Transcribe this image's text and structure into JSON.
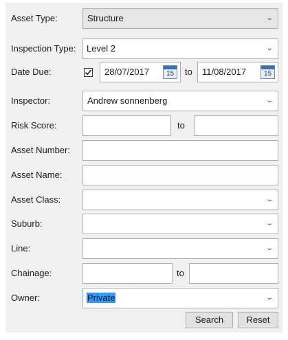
{
  "form": {
    "asset_type": {
      "label": "Asset Type:",
      "value": "Structure"
    },
    "inspection_type": {
      "label": "Inspection Type:",
      "value": "Level 2"
    },
    "date_due": {
      "label": "Date Due:",
      "checked": true,
      "from": "28/07/2017",
      "to_label": "to",
      "to": "11/08/2017",
      "calendar_day": "15"
    },
    "inspector": {
      "label": "Inspector:",
      "value": "Andrew sonnenberg"
    },
    "risk_score": {
      "label": "Risk Score:",
      "to_label": "to",
      "from": "",
      "to": ""
    },
    "asset_number": {
      "label": "Asset Number:",
      "value": ""
    },
    "asset_name": {
      "label": "Asset Name:",
      "value": ""
    },
    "asset_class": {
      "label": "Asset Class:",
      "value": ""
    },
    "suburb": {
      "label": "Suburb:",
      "value": ""
    },
    "line": {
      "label": "Line:",
      "value": ""
    },
    "chainage": {
      "label": "Chainage:",
      "to_label": "to",
      "from": "",
      "to": ""
    },
    "owner": {
      "label": "Owner:",
      "value": "Private"
    }
  },
  "buttons": {
    "search": "Search",
    "reset": "Reset"
  },
  "icons": {
    "dropdown": "chevron-down-icon",
    "calendar": "calendar-icon",
    "check": "checkmark-icon"
  },
  "colors": {
    "selection": "#3399ff",
    "panel": "#f0f0f0"
  }
}
